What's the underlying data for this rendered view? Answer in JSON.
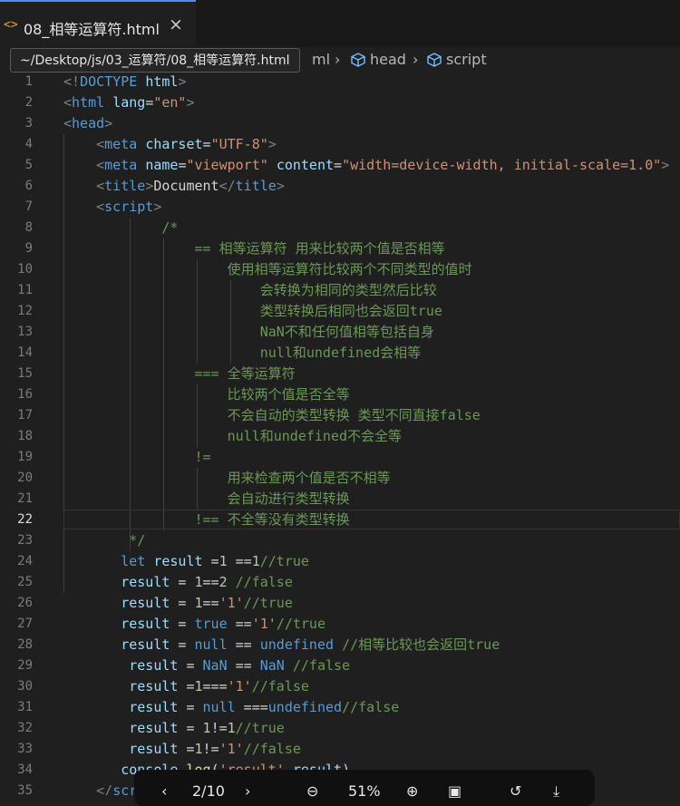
{
  "tab": {
    "icon": "html-file-icon",
    "label": "08_相等运算符.html",
    "close_glyph": "×"
  },
  "breadcrumb": {
    "html_part": "ml",
    "head": "head",
    "script": "script"
  },
  "tooltip": "~/Desktop/js/03_运算符/08_相等运算符.html",
  "lines": [
    {
      "n": "1",
      "active": false,
      "tokens": [
        [
          "t-br",
          "<!"
        ],
        [
          "t-tag",
          "DOCTYPE"
        ],
        [
          "t-txt",
          " "
        ],
        [
          "t-attr",
          "html"
        ],
        [
          "t-br",
          ">"
        ]
      ]
    },
    {
      "n": "2",
      "active": false,
      "tokens": [
        [
          "t-br",
          "<"
        ],
        [
          "t-tag",
          "html"
        ],
        [
          "t-txt",
          " "
        ],
        [
          "t-attr",
          "lang"
        ],
        [
          "t-txt",
          "="
        ],
        [
          "t-str",
          "\"en\""
        ],
        [
          "t-br",
          ">"
        ]
      ]
    },
    {
      "n": "3",
      "active": false,
      "tokens": [
        [
          "t-br",
          "<"
        ],
        [
          "t-tag",
          "head"
        ],
        [
          "t-br",
          ">"
        ]
      ]
    },
    {
      "n": "4",
      "active": false,
      "tokens": [
        [
          "t-txt",
          "    "
        ],
        [
          "t-br",
          "<"
        ],
        [
          "t-tag",
          "meta"
        ],
        [
          "t-txt",
          " "
        ],
        [
          "t-attr",
          "charset"
        ],
        [
          "t-txt",
          "="
        ],
        [
          "t-str",
          "\"UTF-8\""
        ],
        [
          "t-br",
          ">"
        ]
      ]
    },
    {
      "n": "5",
      "active": false,
      "tokens": [
        [
          "t-txt",
          "    "
        ],
        [
          "t-br",
          "<"
        ],
        [
          "t-tag",
          "meta"
        ],
        [
          "t-txt",
          " "
        ],
        [
          "t-attr",
          "name"
        ],
        [
          "t-txt",
          "="
        ],
        [
          "t-str",
          "\"viewport\""
        ],
        [
          "t-txt",
          " "
        ],
        [
          "t-attr",
          "content"
        ],
        [
          "t-txt",
          "="
        ],
        [
          "t-str",
          "\"width=device-width, initial-scale=1.0\""
        ],
        [
          "t-br",
          ">"
        ]
      ]
    },
    {
      "n": "6",
      "active": false,
      "tokens": [
        [
          "t-txt",
          "    "
        ],
        [
          "t-br",
          "<"
        ],
        [
          "t-tag",
          "title"
        ],
        [
          "t-br",
          ">"
        ],
        [
          "t-txt",
          "Document"
        ],
        [
          "t-br",
          "</"
        ],
        [
          "t-tag",
          "title"
        ],
        [
          "t-br",
          ">"
        ]
      ]
    },
    {
      "n": "7",
      "active": false,
      "tokens": [
        [
          "t-txt",
          "    "
        ],
        [
          "t-br",
          "<"
        ],
        [
          "t-tag",
          "script"
        ],
        [
          "t-br",
          ">"
        ]
      ]
    },
    {
      "n": "8",
      "active": false,
      "tokens": [
        [
          "t-txt",
          "            "
        ],
        [
          "t-com",
          "/*"
        ]
      ]
    },
    {
      "n": "9",
      "active": false,
      "tokens": [
        [
          "t-txt",
          "                "
        ],
        [
          "t-com",
          "== 相等运算符 用来比较两个值是否相等"
        ]
      ]
    },
    {
      "n": "10",
      "active": false,
      "tokens": [
        [
          "t-txt",
          "                    "
        ],
        [
          "t-com",
          "使用相等运算符比较两个不同类型的值时"
        ]
      ]
    },
    {
      "n": "11",
      "active": false,
      "tokens": [
        [
          "t-txt",
          "                        "
        ],
        [
          "t-com",
          "会转换为相同的类型然后比较"
        ]
      ]
    },
    {
      "n": "12",
      "active": false,
      "tokens": [
        [
          "t-txt",
          "                        "
        ],
        [
          "t-com",
          "类型转换后相同也会返回true"
        ]
      ]
    },
    {
      "n": "13",
      "active": false,
      "tokens": [
        [
          "t-txt",
          "                        "
        ],
        [
          "t-com",
          "NaN不和任何值相等包括自身"
        ]
      ]
    },
    {
      "n": "14",
      "active": false,
      "tokens": [
        [
          "t-txt",
          "                        "
        ],
        [
          "t-com",
          "null和undefined会相等"
        ]
      ]
    },
    {
      "n": "15",
      "active": false,
      "tokens": [
        [
          "t-txt",
          "                "
        ],
        [
          "t-com",
          "=== 全等运算符"
        ]
      ]
    },
    {
      "n": "16",
      "active": false,
      "tokens": [
        [
          "t-txt",
          "                    "
        ],
        [
          "t-com",
          "比较两个值是否全等"
        ]
      ]
    },
    {
      "n": "17",
      "active": false,
      "tokens": [
        [
          "t-txt",
          "                    "
        ],
        [
          "t-com",
          "不会自动的类型转换 类型不同直接false"
        ]
      ]
    },
    {
      "n": "18",
      "active": false,
      "tokens": [
        [
          "t-txt",
          "                    "
        ],
        [
          "t-com",
          "null和undefined不会全等"
        ]
      ]
    },
    {
      "n": "19",
      "active": false,
      "tokens": [
        [
          "t-txt",
          "                "
        ],
        [
          "t-com",
          "!="
        ]
      ]
    },
    {
      "n": "20",
      "active": false,
      "tokens": [
        [
          "t-txt",
          "                    "
        ],
        [
          "t-com",
          "用来检查两个值是否不相等"
        ]
      ]
    },
    {
      "n": "21",
      "active": false,
      "tokens": [
        [
          "t-txt",
          "                    "
        ],
        [
          "t-com",
          "会自动进行类型转换"
        ]
      ]
    },
    {
      "n": "22",
      "active": true,
      "tokens": [
        [
          "t-txt",
          "                "
        ],
        [
          "t-com",
          "!== 不全等没有类型转换"
        ]
      ]
    },
    {
      "n": "23",
      "active": false,
      "tokens": [
        [
          "t-txt",
          "        "
        ],
        [
          "t-com",
          "*/"
        ]
      ]
    },
    {
      "n": "24",
      "active": false,
      "tokens": [
        [
          "t-txt",
          "       "
        ],
        [
          "t-kw",
          "let"
        ],
        [
          "t-txt",
          " "
        ],
        [
          "t-var",
          "result"
        ],
        [
          "t-txt",
          " ="
        ],
        [
          "t-num",
          "1"
        ],
        [
          "t-txt",
          " =="
        ],
        [
          "t-num",
          "1"
        ],
        [
          "t-com",
          "//true"
        ]
      ]
    },
    {
      "n": "25",
      "active": false,
      "tokens": [
        [
          "t-txt",
          "       "
        ],
        [
          "t-var",
          "result"
        ],
        [
          "t-txt",
          " = "
        ],
        [
          "t-num",
          "1"
        ],
        [
          "t-txt",
          "=="
        ],
        [
          "t-num",
          "2"
        ],
        [
          "t-txt",
          " "
        ],
        [
          "t-com",
          "//false"
        ]
      ]
    },
    {
      "n": "26",
      "active": false,
      "tokens": [
        [
          "t-txt",
          "       "
        ],
        [
          "t-var",
          "result"
        ],
        [
          "t-txt",
          " = "
        ],
        [
          "t-num",
          "1"
        ],
        [
          "t-txt",
          "=="
        ],
        [
          "t-str",
          "'1'"
        ],
        [
          "t-com",
          "//true"
        ]
      ]
    },
    {
      "n": "27",
      "active": false,
      "tokens": [
        [
          "t-txt",
          "       "
        ],
        [
          "t-var",
          "result"
        ],
        [
          "t-txt",
          " = "
        ],
        [
          "t-kw",
          "true"
        ],
        [
          "t-txt",
          " =="
        ],
        [
          "t-str",
          "'1'"
        ],
        [
          "t-com",
          "//true"
        ]
      ]
    },
    {
      "n": "28",
      "active": false,
      "tokens": [
        [
          "t-txt",
          "       "
        ],
        [
          "t-var",
          "result"
        ],
        [
          "t-txt",
          " = "
        ],
        [
          "t-kw",
          "null"
        ],
        [
          "t-txt",
          " == "
        ],
        [
          "t-kw",
          "undefined"
        ],
        [
          "t-txt",
          " "
        ],
        [
          "t-com",
          "//相等比较也会返回true"
        ]
      ]
    },
    {
      "n": "29",
      "active": false,
      "tokens": [
        [
          "t-txt",
          "        "
        ],
        [
          "t-var",
          "result"
        ],
        [
          "t-txt",
          " = "
        ],
        [
          "t-kw",
          "NaN"
        ],
        [
          "t-txt",
          " == "
        ],
        [
          "t-kw",
          "NaN"
        ],
        [
          "t-txt",
          " "
        ],
        [
          "t-com",
          "//false"
        ]
      ]
    },
    {
      "n": "30",
      "active": false,
      "tokens": [
        [
          "t-txt",
          "        "
        ],
        [
          "t-var",
          "result"
        ],
        [
          "t-txt",
          " ="
        ],
        [
          "t-num",
          "1"
        ],
        [
          "t-txt",
          "==="
        ],
        [
          "t-str",
          "'1'"
        ],
        [
          "t-com",
          "//false"
        ]
      ]
    },
    {
      "n": "31",
      "active": false,
      "tokens": [
        [
          "t-txt",
          "        "
        ],
        [
          "t-var",
          "result"
        ],
        [
          "t-txt",
          " = "
        ],
        [
          "t-kw",
          "null"
        ],
        [
          "t-txt",
          " ==="
        ],
        [
          "t-kw",
          "undefined"
        ],
        [
          "t-com",
          "//false"
        ]
      ]
    },
    {
      "n": "32",
      "active": false,
      "tokens": [
        [
          "t-txt",
          "        "
        ],
        [
          "t-var",
          "result"
        ],
        [
          "t-txt",
          " = "
        ],
        [
          "t-num",
          "1"
        ],
        [
          "t-txt",
          "!="
        ],
        [
          "t-num",
          "1"
        ],
        [
          "t-com",
          "//true"
        ]
      ]
    },
    {
      "n": "33",
      "active": false,
      "tokens": [
        [
          "t-txt",
          "        "
        ],
        [
          "t-var",
          "result"
        ],
        [
          "t-txt",
          " ="
        ],
        [
          "t-num",
          "1"
        ],
        [
          "t-txt",
          "!="
        ],
        [
          "t-str",
          "'1'"
        ],
        [
          "t-com",
          "//false"
        ]
      ]
    },
    {
      "n": "34",
      "active": false,
      "tokens": [
        [
          "t-txt",
          "       "
        ],
        [
          "t-var",
          "console"
        ],
        [
          "t-txt",
          "."
        ],
        [
          "t-fn",
          "log"
        ],
        [
          "t-txt",
          "("
        ],
        [
          "t-str",
          "'result'"
        ],
        [
          "t-txt",
          ","
        ],
        [
          "t-var",
          "result"
        ],
        [
          "t-txt",
          ")"
        ]
      ]
    },
    {
      "n": "35",
      "active": false,
      "tokens": [
        [
          "t-txt",
          "    "
        ],
        [
          "t-br",
          "</"
        ],
        [
          "t-tag",
          "script"
        ],
        [
          "t-br",
          ">"
        ]
      ]
    }
  ],
  "dock": {
    "page": "2/10",
    "zoom": "51%"
  },
  "colors": {
    "accent": "#4d8ee8",
    "comment": "#6a9955",
    "string": "#ce9178",
    "keyword": "#569cd6"
  }
}
